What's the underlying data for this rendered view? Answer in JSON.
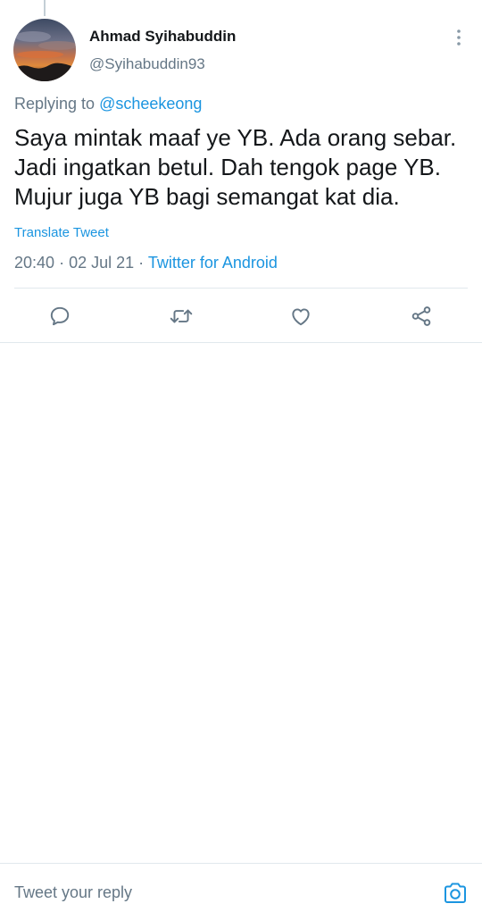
{
  "tweet": {
    "author": {
      "display_name": "Ahmad Syihabuddin",
      "handle": "@Syihabuddin93",
      "avatar": "sunset-photo"
    },
    "replying_to": {
      "prefix": "Replying to",
      "mention": "@scheekeong"
    },
    "text": "Saya mintak maaf ye YB. Ada orang sebar. Jadi ingatkan betul. Dah tengok page YB. Mujur juga YB bagi semangat kat dia.",
    "translate_label": "Translate Tweet",
    "time": "20:40",
    "separator": "·",
    "date": "02 Jul 21",
    "source": "Twitter for Android"
  },
  "actions": {
    "reply_icon": "reply-icon",
    "retweet_icon": "retweet-icon",
    "like_icon": "heart-icon",
    "share_icon": "share-icon"
  },
  "reply_bar": {
    "placeholder": "Tweet your reply",
    "camera_icon": "camera-icon"
  },
  "colors": {
    "accent": "#1b95e0",
    "secondary_text": "#657786",
    "primary_text": "#14171a",
    "divider": "#e1e8ed"
  }
}
